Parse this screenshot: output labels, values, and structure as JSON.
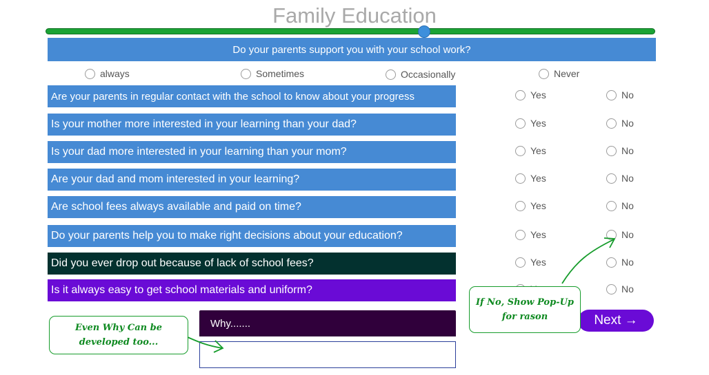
{
  "title": "Family Education",
  "progress": {
    "value": 0.62
  },
  "main_question": {
    "text": "Do your parents support you with your school work?",
    "options": [
      "always",
      "Sometimes",
      "Occasionally",
      "Never"
    ]
  },
  "yes_label": "Yes",
  "no_label": "No",
  "questions": [
    {
      "text": "Are your parents in regular contact with the school to know about your progress",
      "color": "#468ad4"
    },
    {
      "text": "Is your mother more interested in your learning than your dad?",
      "color": "#468ad4"
    },
    {
      "text": "Is your dad more interested in your learning than your mom?",
      "color": "#468ad4"
    },
    {
      "text": "Are your dad and mom interested in your learning?",
      "color": "#468ad4"
    },
    {
      "text": "Are school fees always available and paid on time?",
      "color": "#468ad4"
    },
    {
      "text": "Do your parents help you to make right decisions about your education?",
      "color": "#468ad4"
    },
    {
      "text": "Did you ever drop out because of lack of school fees?",
      "color": "#03312f"
    },
    {
      "text": "Is it always easy to get school materials and uniform?",
      "color": "#6a0bd6"
    }
  ],
  "why": {
    "label": "Why.......",
    "value": ""
  },
  "next_button": {
    "label": "Next →"
  },
  "annotations": {
    "left": [
      "Even Why Can be",
      "developed too..."
    ],
    "right": [
      "If No, Show Pop-Up",
      "for rason"
    ]
  },
  "colors": {
    "accent_blue": "#468ad4",
    "accent_purple": "#6a0bd6",
    "note_green": "#169c2b"
  }
}
